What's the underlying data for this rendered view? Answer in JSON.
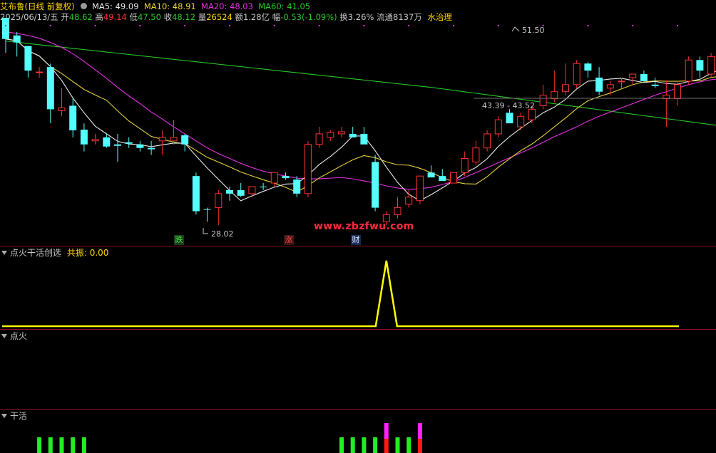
{
  "header": {
    "stock_name": "艾布鲁",
    "mode": "(日线 前复权)",
    "ma5_label": "MA5:",
    "ma5_value": "49.09",
    "ma10_label": "MA10:",
    "ma10_value": "48.91",
    "ma20_label": "MA20:",
    "ma20_value": "48.03",
    "ma60_label": "MA60:",
    "ma60_value": "41.05",
    "gear_icon": "gear-icon"
  },
  "quote": {
    "date": "2025/06/13/五",
    "open_label": "开",
    "open": "48.62",
    "high_label": "高",
    "high": "49.14",
    "low_label": "低",
    "low": "47.50",
    "close_label": "收",
    "close": "48.12",
    "volume_label": "量",
    "volume": "26524",
    "amount_label": "额",
    "amount": "1.28亿",
    "change_label": "幅",
    "change": "-0.53(-1.09%)",
    "turnover_label": "换",
    "turnover": "3.26%",
    "float_label": "流通",
    "float_shares": "8137万",
    "sector": "水治理"
  },
  "annotations": {
    "high_mark": "51.50",
    "low_mark": "28.02",
    "range_mark": "43.39 - 43.52"
  },
  "badges": {
    "die": "跌",
    "zhang": "涨",
    "cai": "财"
  },
  "watermark": "www.zbzfwu.com",
  "panels": {
    "indicator1_title": "点火干活创选",
    "indicator1_param_label": "共振:",
    "indicator1_param_value": "0.00",
    "indicator2_title": "点火",
    "indicator3_title": "干活"
  },
  "colors": {
    "up": "#ff3232",
    "down": "#54ffff",
    "ma5": "#e8e8e8",
    "ma10": "#e6d23c",
    "ma20": "#e632e6",
    "ma60": "#28c828",
    "resonance": "#ffff00",
    "bar_green": "#22ee22",
    "bar_magenta": "#ff22ff",
    "bar_red": "#ff1818"
  },
  "candles": [
    [
      57.5,
      57.5,
      52.5,
      54.5
    ],
    [
      55.0,
      55.5,
      52.0,
      54.0
    ],
    [
      53.5,
      53.5,
      49.0,
      50.0
    ],
    [
      49.8,
      50.5,
      49.0,
      49.8
    ],
    [
      50.5,
      51.0,
      42.5,
      44.5
    ],
    [
      44.3,
      47.5,
      43.5,
      44.7
    ],
    [
      45.0,
      46.0,
      40.5,
      41.5
    ],
    [
      41.6,
      42.5,
      38.5,
      39.5
    ],
    [
      40.0,
      41.0,
      39.5,
      40.2
    ],
    [
      40.5,
      41.0,
      39.0,
      39.2
    ],
    [
      39.5,
      41.0,
      37.0,
      39.3
    ],
    [
      39.8,
      40.5,
      39.0,
      39.6
    ],
    [
      39.5,
      40.0,
      38.5,
      39.0
    ],
    [
      39.0,
      40.0,
      38.0,
      38.8
    ],
    [
      40.0,
      41.5,
      38.0,
      40.5
    ],
    [
      40.0,
      43.0,
      39.5,
      40.5
    ],
    [
      40.8,
      41.0,
      38.5,
      39.5
    ],
    [
      35.0,
      35.5,
      29.5,
      30.0
    ],
    [
      30.3,
      30.5,
      28.5,
      30.2
    ],
    [
      30.5,
      33.0,
      28.0,
      32.5
    ],
    [
      33.0,
      33.5,
      31.5,
      32.5
    ],
    [
      33.0,
      34.0,
      32.0,
      32.2
    ],
    [
      32.5,
      33.5,
      32.0,
      33.5
    ],
    [
      33.5,
      34.0,
      33.0,
      33.4
    ],
    [
      34.0,
      35.0,
      33.5,
      35.5
    ],
    [
      35.0,
      35.5,
      34.5,
      34.7
    ],
    [
      34.5,
      35.0,
      32.0,
      32.5
    ],
    [
      32.5,
      40.0,
      32.0,
      39.5
    ],
    [
      39.5,
      42.0,
      39.0,
      41.0
    ],
    [
      40.5,
      41.5,
      40.0,
      41.2
    ],
    [
      41.0,
      42.0,
      40.5,
      41.3
    ],
    [
      41.0,
      42.0,
      40.5,
      40.5
    ],
    [
      41.0,
      42.0,
      40.0,
      39.5
    ],
    [
      37.0,
      38.0,
      30.0,
      30.5
    ],
    [
      28.5,
      30.0,
      28.0,
      29.5
    ],
    [
      29.5,
      32.0,
      29.0,
      30.5
    ],
    [
      31.0,
      33.0,
      30.5,
      32.0
    ],
    [
      31.5,
      35.0,
      31.0,
      35.0
    ],
    [
      35.5,
      36.5,
      35.0,
      34.8
    ],
    [
      35.0,
      36.0,
      34.5,
      34.3
    ],
    [
      34.0,
      35.5,
      34.0,
      35.5
    ],
    [
      35.5,
      38.5,
      35.0,
      37.5
    ],
    [
      37.0,
      40.0,
      36.5,
      39.0
    ],
    [
      39.0,
      41.5,
      38.5,
      41.0
    ],
    [
      41.0,
      43.5,
      40.5,
      43.0
    ],
    [
      44.0,
      44.5,
      42.5,
      42.5
    ],
    [
      42.0,
      44.0,
      41.5,
      43.5
    ],
    [
      43.0,
      45.0,
      42.5,
      44.5
    ],
    [
      45.0,
      48.0,
      44.5,
      46.5
    ],
    [
      46.0,
      50.0,
      45.5,
      47.0
    ],
    [
      47.0,
      51.0,
      46.5,
      48.0
    ],
    [
      48.0,
      51.5,
      47.5,
      51.0
    ],
    [
      51.0,
      51.2,
      49.0,
      50.0
    ],
    [
      49.0,
      50.5,
      46.5,
      47.0
    ],
    [
      47.5,
      48.5,
      46.5,
      48.0
    ],
    [
      48.5,
      49.0,
      47.5,
      48.5
    ],
    [
      49.0,
      49.5,
      48.0,
      49.5
    ],
    [
      49.5,
      50.0,
      48.5,
      48.5
    ],
    [
      48.0,
      49.0,
      47.5,
      47.8
    ],
    [
      46.0,
      48.5,
      42.0,
      46.5
    ],
    [
      46.0,
      48.5,
      45.0,
      48.0
    ],
    [
      48.5,
      52.0,
      48.0,
      51.5
    ],
    [
      51.5,
      52.0,
      49.0,
      50.0
    ],
    [
      49.5,
      52.5,
      49.0,
      52.0
    ],
    [
      52.0,
      52.5,
      49.5,
      50.0
    ],
    [
      50.0,
      50.5,
      49.5,
      49.8
    ],
    [
      50.0,
      51.5,
      49.5,
      50.5
    ],
    [
      50.5,
      52.0,
      50.0,
      51.0
    ],
    [
      50.5,
      51.0,
      48.0,
      48.5
    ],
    [
      48.6,
      49.1,
      47.5,
      48.1
    ]
  ],
  "resonance_values": [
    0,
    0,
    0,
    0,
    0,
    0,
    0,
    0,
    0,
    0,
    0,
    0,
    0,
    0,
    0,
    0,
    0,
    0,
    0,
    0,
    0,
    0,
    0,
    0,
    0,
    0,
    0,
    0,
    0,
    0,
    0,
    0,
    0,
    0,
    1,
    0,
    0,
    0,
    0,
    0,
    0,
    0,
    0,
    0,
    0,
    0,
    0,
    0,
    0,
    0,
    0,
    0,
    0,
    0,
    0,
    0,
    0,
    0,
    0,
    0,
    0,
    0,
    0,
    0,
    0,
    0,
    0,
    0,
    0,
    0
  ],
  "ganhuo_bars": [
    {
      "i": 3,
      "color": "green"
    },
    {
      "i": 4,
      "color": "green"
    },
    {
      "i": 5,
      "color": "green"
    },
    {
      "i": 6,
      "color": "green"
    },
    {
      "i": 7,
      "color": "green"
    },
    {
      "i": 30,
      "color": "green"
    },
    {
      "i": 31,
      "color": "green"
    },
    {
      "i": 32,
      "color": "green"
    },
    {
      "i": 33,
      "color": "green"
    },
    {
      "i": 34,
      "color": "magenta-red"
    },
    {
      "i": 35,
      "color": "green"
    },
    {
      "i": 36,
      "color": "green"
    },
    {
      "i": 37,
      "color": "magenta-red"
    }
  ]
}
